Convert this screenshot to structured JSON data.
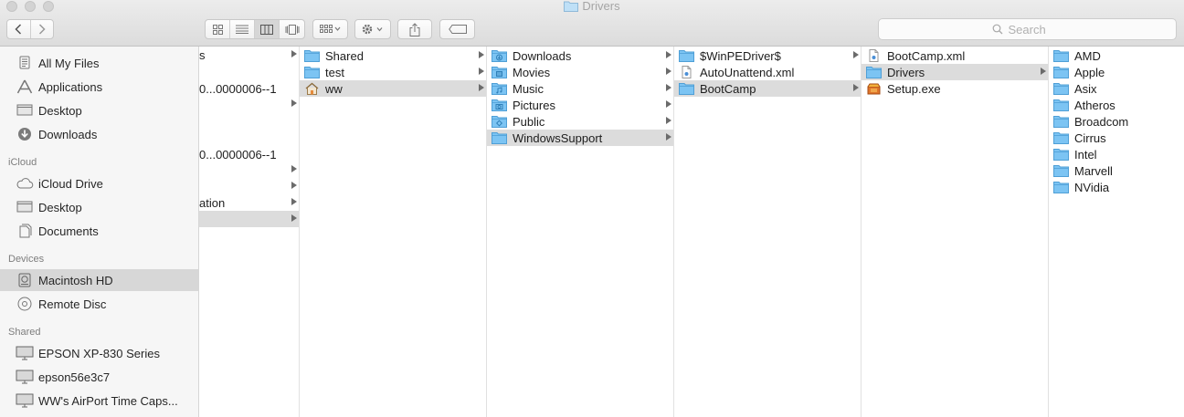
{
  "window": {
    "title": "Drivers"
  },
  "toolbar": {
    "back_icon": "chevron-left-icon",
    "forward_icon": "chevron-right-icon",
    "view_modes": [
      "icon-view-icon",
      "list-view-icon",
      "column-view-icon",
      "cover-flow-icon"
    ],
    "active_view": "column-view-icon",
    "search_placeholder": "Search"
  },
  "sidebar": {
    "favorites": [
      {
        "label": "All My Files",
        "icon": "all-files-icon"
      },
      {
        "label": "Applications",
        "icon": "applications-icon"
      },
      {
        "label": "Desktop",
        "icon": "desktop-icon"
      },
      {
        "label": "Downloads",
        "icon": "downloads-icon"
      }
    ],
    "icloud_header": "iCloud",
    "icloud": [
      {
        "label": "iCloud Drive",
        "icon": "cloud-icon"
      },
      {
        "label": "Desktop",
        "icon": "desktop-icon"
      },
      {
        "label": "Documents",
        "icon": "documents-icon"
      }
    ],
    "devices_header": "Devices",
    "devices": [
      {
        "label": "Macintosh HD",
        "icon": "hard-drive-icon",
        "selected": true
      },
      {
        "label": "Remote Disc",
        "icon": "disc-icon"
      }
    ],
    "shared_header": "Shared",
    "shared": [
      {
        "label": "EPSON XP-830 Series",
        "icon": "monitor-icon"
      },
      {
        "label": "epson56e3c7",
        "icon": "monitor-icon"
      },
      {
        "label": "WW's AirPort Time Caps...",
        "icon": "monitor-icon"
      }
    ]
  },
  "columns": {
    "col0": [
      {
        "label": "s",
        "chevron": true
      },
      {
        "label": "",
        "chevron": false
      },
      {
        "label": "0...0000006--1",
        "chevron": false
      },
      {
        "label": "",
        "chevron": true
      },
      {
        "label": "",
        "chevron": false
      },
      {
        "label": "",
        "chevron": false
      },
      {
        "label": "0...0000006--1",
        "chevron": false
      },
      {
        "label": "",
        "chevron": true
      },
      {
        "label": "",
        "chevron": true
      },
      {
        "label": "ation",
        "chevron": true
      },
      {
        "label": "",
        "chevron": true,
        "selected": true
      }
    ],
    "col1": [
      {
        "label": "Shared",
        "icon": "folder-icon",
        "chevron": true
      },
      {
        "label": "test",
        "icon": "folder-icon",
        "chevron": true
      },
      {
        "label": "ww",
        "icon": "home-icon",
        "chevron": true,
        "selected": true
      }
    ],
    "col2": [
      {
        "label": "Downloads",
        "icon": "downloads-folder-icon",
        "chevron": true
      },
      {
        "label": "Movies",
        "icon": "movies-folder-icon",
        "chevron": true
      },
      {
        "label": "Music",
        "icon": "music-folder-icon",
        "chevron": true
      },
      {
        "label": "Pictures",
        "icon": "pictures-folder-icon",
        "chevron": true
      },
      {
        "label": "Public",
        "icon": "public-folder-icon",
        "chevron": true
      },
      {
        "label": "WindowsSupport",
        "icon": "folder-icon",
        "chevron": true,
        "selected": true
      }
    ],
    "col3": [
      {
        "label": "$WinPEDriver$",
        "icon": "folder-icon",
        "chevron": true
      },
      {
        "label": "AutoUnattend.xml",
        "icon": "xml-file-icon",
        "chevron": false
      },
      {
        "label": "BootCamp",
        "icon": "folder-icon",
        "chevron": true,
        "selected": true
      }
    ],
    "col4": [
      {
        "label": "BootCamp.xml",
        "icon": "xml-file-icon",
        "chevron": false
      },
      {
        "label": "Drivers",
        "icon": "folder-icon",
        "chevron": true,
        "selected": true
      },
      {
        "label": "Setup.exe",
        "icon": "installer-icon",
        "chevron": false
      }
    ],
    "col5": [
      {
        "label": "AMD",
        "icon": "folder-icon",
        "chevron": false
      },
      {
        "label": "Apple",
        "icon": "folder-icon",
        "chevron": false
      },
      {
        "label": "Asix",
        "icon": "folder-icon",
        "chevron": false
      },
      {
        "label": "Atheros",
        "icon": "folder-icon",
        "chevron": false
      },
      {
        "label": "Broadcom",
        "icon": "folder-icon",
        "chevron": false
      },
      {
        "label": "Cirrus",
        "icon": "folder-icon",
        "chevron": false
      },
      {
        "label": "Intel",
        "icon": "folder-icon",
        "chevron": false
      },
      {
        "label": "Marvell",
        "icon": "folder-icon",
        "chevron": false
      },
      {
        "label": "NVidia",
        "icon": "folder-icon",
        "chevron": false
      }
    ]
  },
  "colors": {
    "folder": "#7cc4f3",
    "selection": "#dcdcdc",
    "sidebar": "#f6f6f6"
  }
}
